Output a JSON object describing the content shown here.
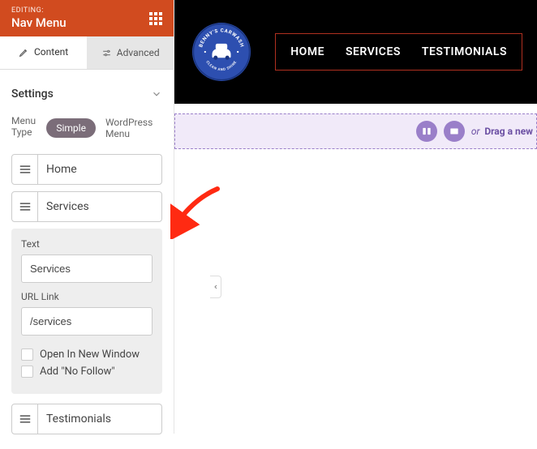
{
  "panel": {
    "editing_label": "EDITING:",
    "title": "Nav Menu",
    "tabs": {
      "content": "Content",
      "advanced": "Advanced"
    },
    "settings_heading": "Settings",
    "menu_type_label": "Menu Type",
    "menu_type_options": {
      "simple": "Simple",
      "wordpress": "WordPress Menu"
    },
    "items": [
      {
        "label": "Home"
      },
      {
        "label": "Services"
      },
      {
        "label": "Testimonials"
      }
    ],
    "expanded": {
      "text_label": "Text",
      "text_value": "Services",
      "url_label": "URL Link",
      "url_value": "/services",
      "open_new_window": "Open In New Window",
      "no_follow": "Add \"No Follow\""
    }
  },
  "preview": {
    "logo": {
      "top_text": "BENNY'S CARWASH",
      "bottom_text": "CLEAN AND SHINE"
    },
    "nav": [
      "HOME",
      "SERVICES",
      "TESTIMONIALS"
    ],
    "drop_hint_or": "or",
    "drop_hint_bold": "Drag a new"
  },
  "colors": {
    "accent": "#d14b1f",
    "logo_bg": "#2d4fb0",
    "purple": "#9a7fc9"
  }
}
